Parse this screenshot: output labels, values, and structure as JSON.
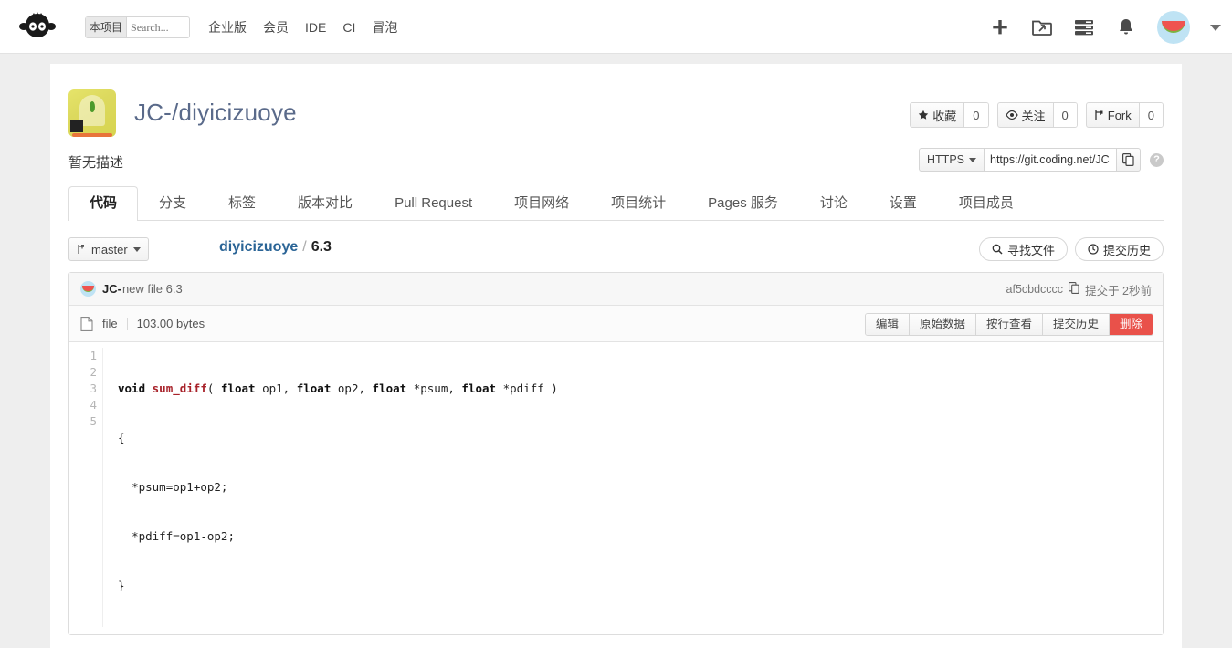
{
  "topbar": {
    "logo_alt": "coding-logo",
    "search": {
      "scope": "本项目",
      "placeholder": "Search...",
      "value": ""
    },
    "nav_links": [
      "企业版",
      "会员",
      "IDE",
      "CI",
      "冒泡"
    ],
    "icons": [
      "plus-icon",
      "folder-share-icon",
      "stack-icon",
      "bell-icon"
    ],
    "avatar_alt": "user-avatar",
    "dropdown_caret": "chevron-down-icon"
  },
  "repo": {
    "title": "JC-/diyicizuoye",
    "description": "暂无描述",
    "stats": [
      {
        "icon": "star-icon",
        "label": "收藏",
        "count": "0"
      },
      {
        "icon": "eye-icon",
        "label": "关注",
        "count": "0"
      },
      {
        "icon": "fork-icon",
        "label": "Fork",
        "count": "0"
      }
    ],
    "clone": {
      "protocol": "HTTPS",
      "url": "https://git.coding.net/JC",
      "copy_icon": "copy-icon",
      "help_icon": "question-icon"
    }
  },
  "tabs": [
    {
      "label": "代码",
      "active": true
    },
    {
      "label": "分支",
      "active": false
    },
    {
      "label": "标签",
      "active": false
    },
    {
      "label": "版本对比",
      "active": false
    },
    {
      "label": "Pull Request",
      "active": false
    },
    {
      "label": "项目网络",
      "active": false
    },
    {
      "label": "项目统计",
      "active": false
    },
    {
      "label": "Pages 服务",
      "active": false
    },
    {
      "label": "讨论",
      "active": false
    },
    {
      "label": "设置",
      "active": false
    },
    {
      "label": "项目成员",
      "active": false
    }
  ],
  "breadcrumb": {
    "branch": "master",
    "repo_name": "diyicizuoye",
    "separator": "/",
    "file_name": "6.3"
  },
  "actions": {
    "find_file": "寻找文件",
    "commit_history": "提交历史"
  },
  "commit": {
    "author": "JC-",
    "message": "new file 6.3",
    "sha": "af5cbdcccc",
    "time": "提交于 2秒前"
  },
  "file": {
    "type_label": "file",
    "size": "103.00 bytes",
    "buttons": [
      "编辑",
      "原始数据",
      "按行查看",
      "提交历史"
    ],
    "delete_button": "删除"
  },
  "code": {
    "line_numbers": [
      "1",
      "2",
      "3",
      "4",
      "5"
    ],
    "lines": [
      "void sum_diff( float op1, float op2, float *psum, float *pdiff )",
      "{",
      "  *psum=op1+op2;",
      "  *pdiff=op1-op2;",
      "}"
    ]
  },
  "colors": {
    "link": "#2a6496",
    "title": "#5a6a8a",
    "danger": "#e9514a",
    "keyword": "#111111",
    "function": "#a8222a"
  }
}
